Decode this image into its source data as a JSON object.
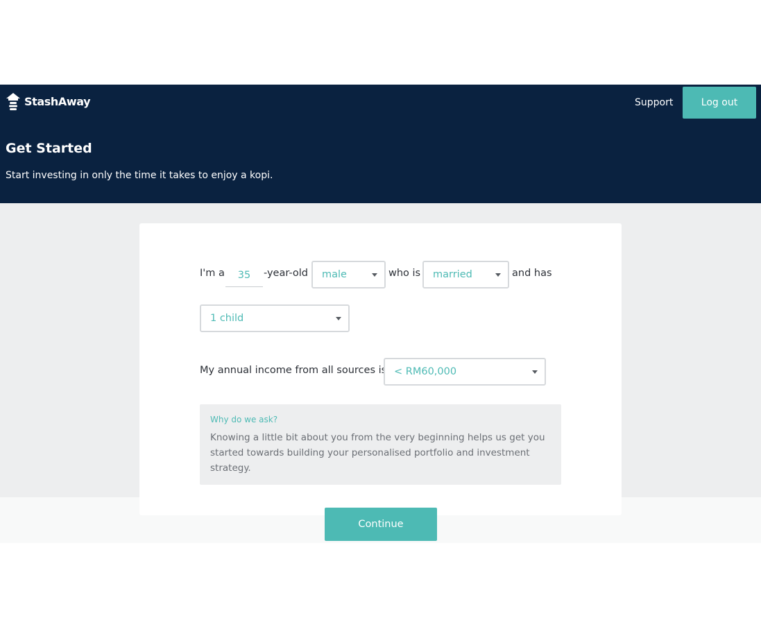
{
  "header": {
    "brand": "StashAway",
    "support_label": "Support",
    "logout_label": "Log out",
    "title": "Get Started",
    "subtitle": "Start investing in only the time it takes to enjoy a kopi."
  },
  "form": {
    "age_prefix": "I'm a",
    "age_value": "35",
    "age_suffix": "-year-old",
    "gender_value": "male",
    "marital_prefix": "who is",
    "marital_value": "married",
    "children_prefix": "and has",
    "children_value": "1 child",
    "income_label": "My annual income from all sources is",
    "income_value": "< RM60,000"
  },
  "info": {
    "title": "Why do we ask?",
    "body": "Knowing a little bit about you from the very beginning helps us get you started towards building your personalised portfolio and investment strategy."
  },
  "actions": {
    "continue_label": "Continue"
  },
  "colors": {
    "header_bg": "#0a2240",
    "accent": "#4dbab4",
    "page_bg": "#edeeef"
  },
  "icons": {
    "logo": "house-stack-icon",
    "dropdown": "caret-down-icon"
  }
}
